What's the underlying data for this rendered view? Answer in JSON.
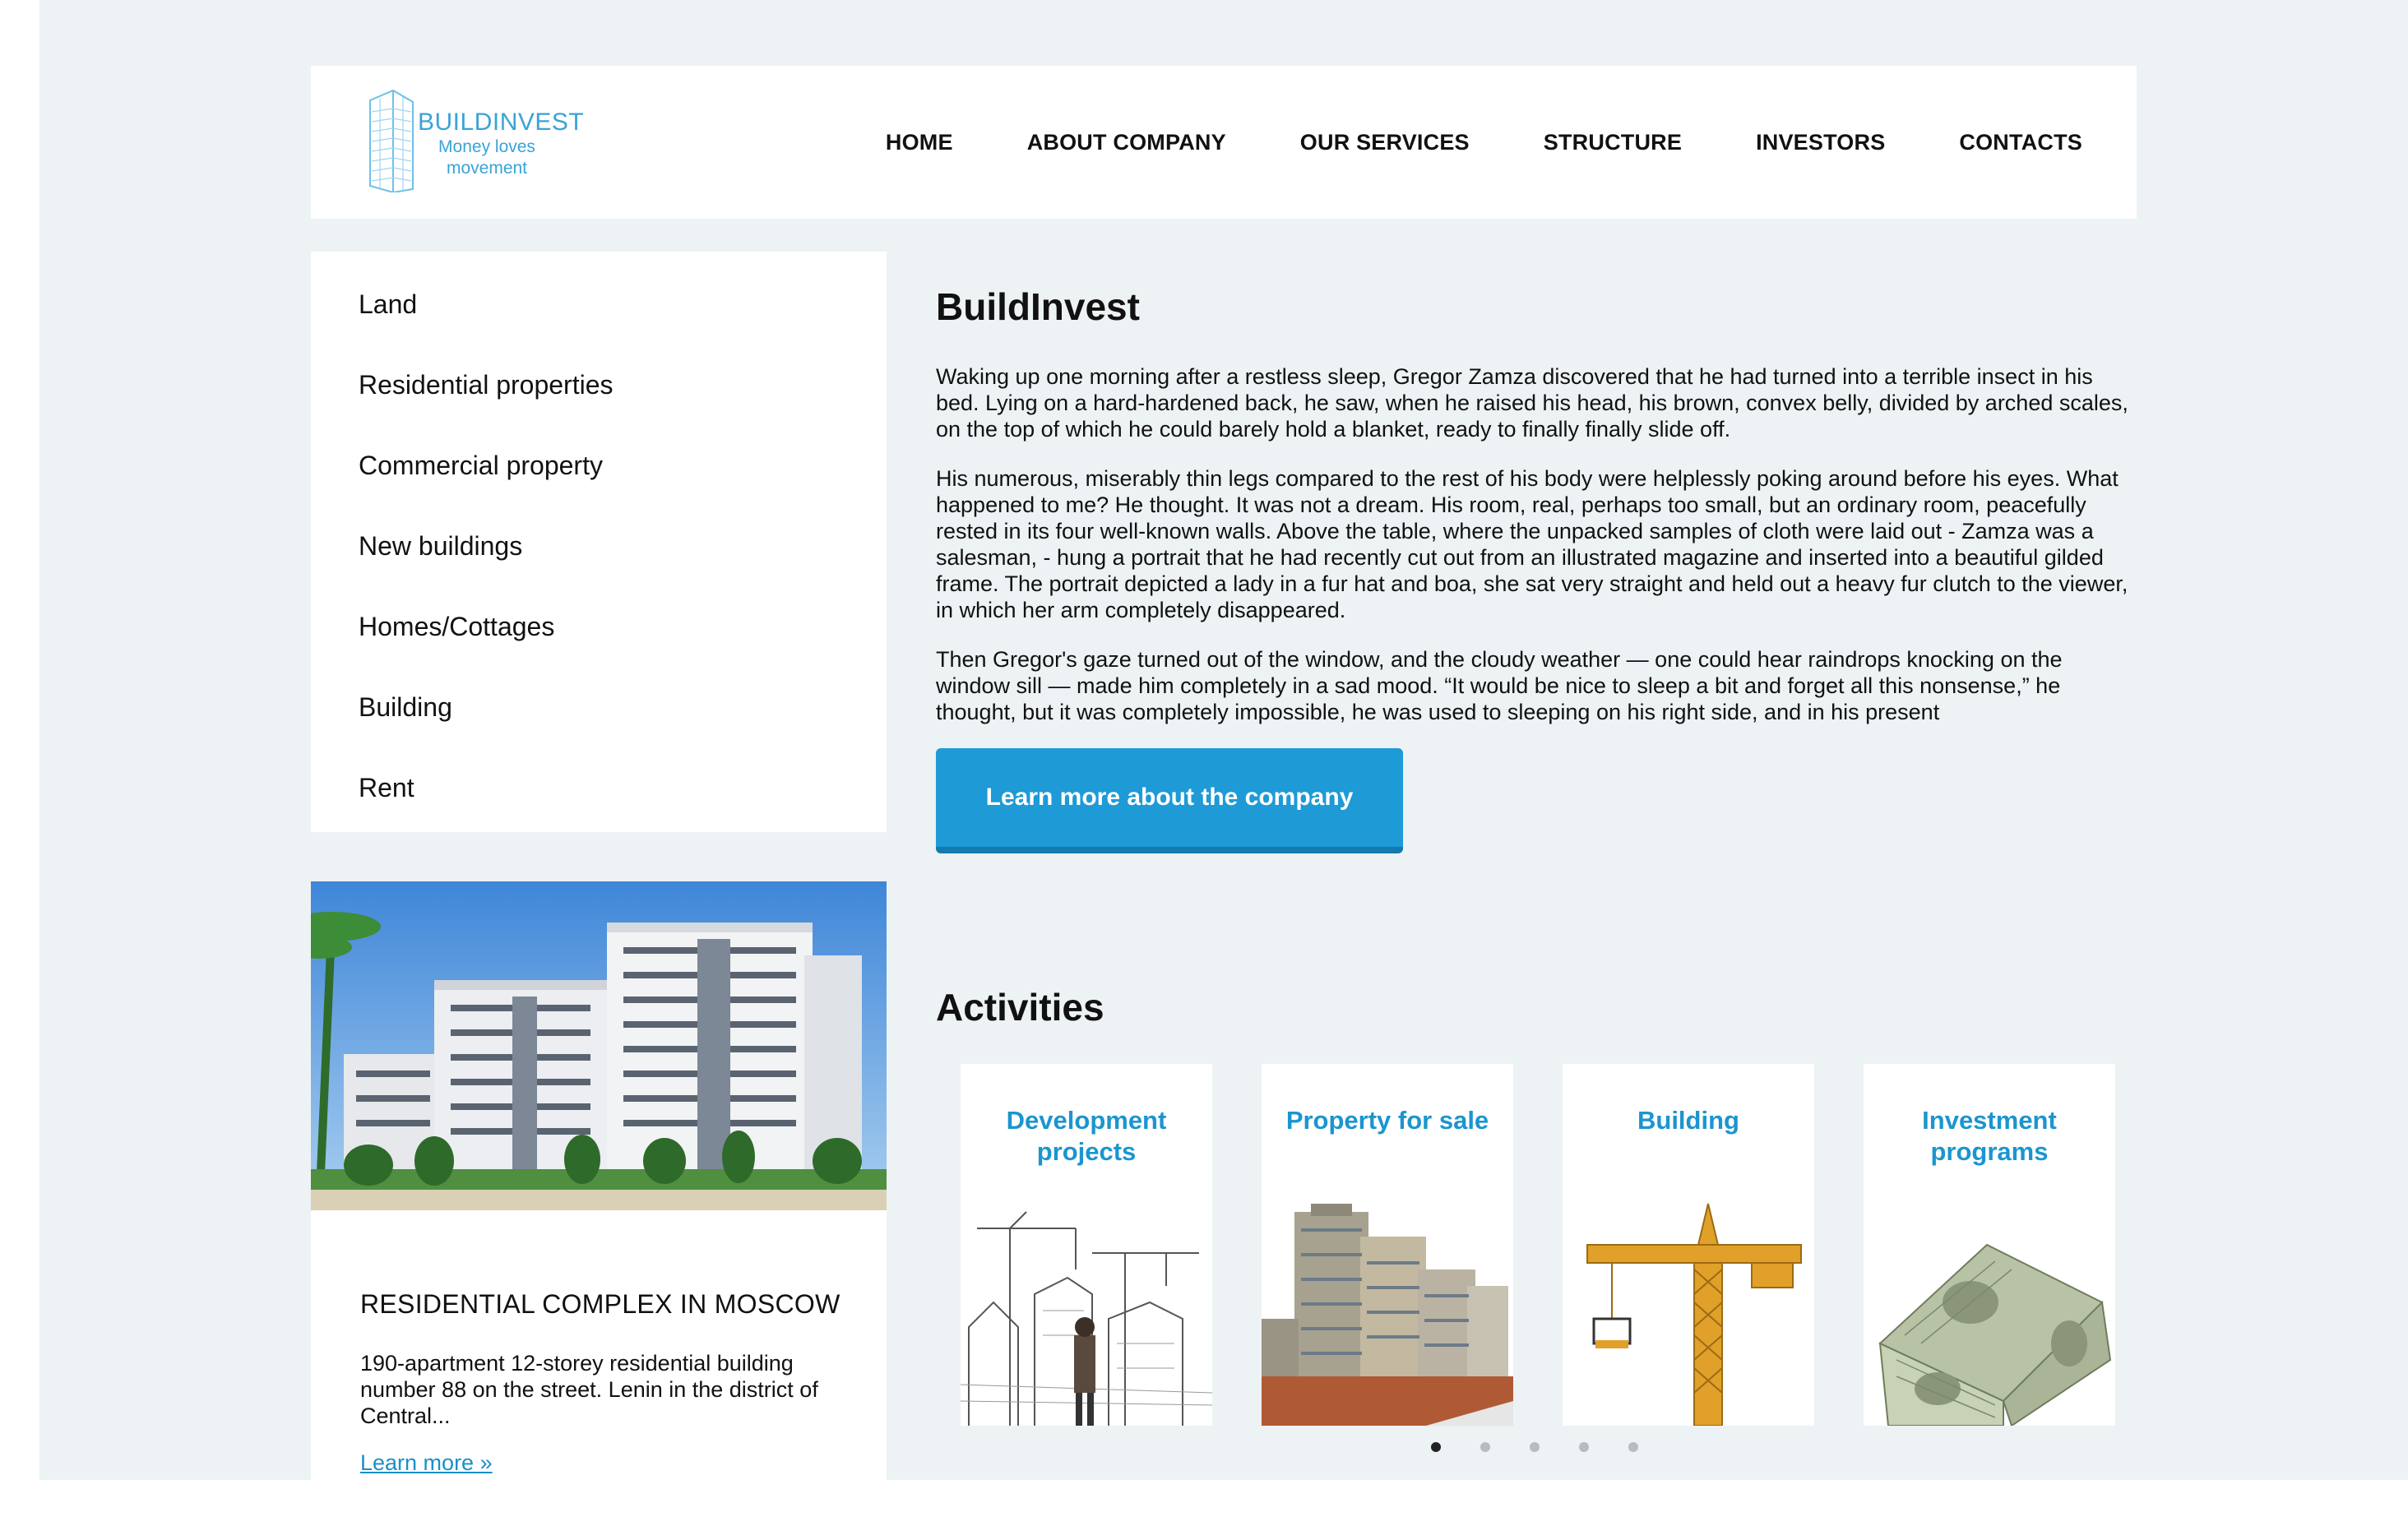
{
  "header": {
    "logo": {
      "brand": "BUILDINVEST",
      "tagline": "Money loves movement",
      "icon": "building-tower-logo"
    },
    "nav": [
      "HOME",
      "ABOUT COMPANY",
      "OUR SERVICES",
      "STRUCTURE",
      "INVESTORS",
      "CONTACTS"
    ]
  },
  "sidebar": {
    "items": [
      "Land",
      "Residential properties",
      "Commercial property",
      "New buildings",
      "Homes/Cottages",
      "Building",
      "Rent"
    ]
  },
  "feature": {
    "title": "RESIDENTIAL COMPLEX IN MOSCOW",
    "text": "190-apartment 12-storey residential building number 88 on the street. Lenin in the district of Central...",
    "link": "Learn more »"
  },
  "main": {
    "title": "BuildInvest",
    "paragraphs": [
      "Waking up one morning after a restless sleep, Gregor Zamza discovered that he had turned into a terrible insect in his bed. Lying on a hard-hardened back, he saw, when he raised his head, his brown, convex belly, divided by arched scales, on the top of which he could barely hold a blanket, ready to finally finally slide off.",
      "His numerous, miserably thin legs compared to the rest of his body were helplessly poking around before his eyes. What happened to me? He thought. It was not a dream. His room, real, perhaps too small, but an ordinary room, peacefully rested in its four well-known walls. Above the table, where the unpacked samples of cloth were laid out - Zamza was a salesman, - hung a portrait that he had recently cut out from an illustrated magazine and inserted into a beautiful gilded frame. The portrait depicted a lady in a fur hat and boa, she sat very straight and held out a heavy fur clutch to the viewer, in which her arm completely disappeared.",
      "Then Gregor's gaze turned out of the window, and the cloudy weather — one could hear raindrops knocking on the window sill — made him completely in a sad mood. “It would be nice to sleep a bit and forget all this nonsense,” he thought, but it was completely impossible, he was used to sleeping on his right side, and in his present"
    ],
    "cta": "Learn more about the company",
    "activities_title": "Activities",
    "activities": [
      {
        "title": "Development projects",
        "image": "crane-sketch-image"
      },
      {
        "title": "Property for sale",
        "image": "highrise-image"
      },
      {
        "title": "Building",
        "image": "tower-crane-image"
      },
      {
        "title": "Investment programs",
        "image": "money-house-image"
      }
    ],
    "carousel": {
      "count": 5,
      "active": 1
    }
  },
  "colors": {
    "accent": "#1e9ad6",
    "link": "#1b8fc7",
    "background": "#edf2f4"
  }
}
